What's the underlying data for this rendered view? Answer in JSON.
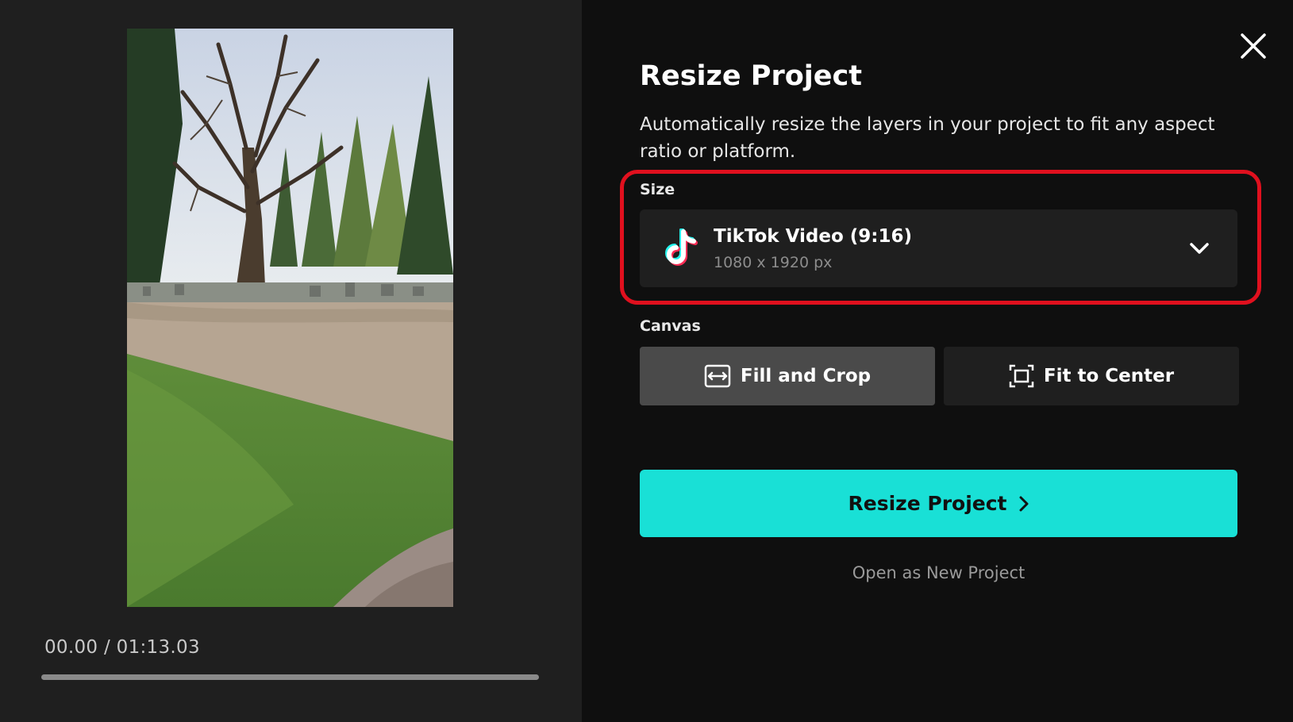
{
  "preview": {
    "current_time": "00.00",
    "separator": " / ",
    "duration": "01:13.03",
    "progress": 0
  },
  "dialog": {
    "title": "Resize Project",
    "description": "Automatically resize the layers in your project to fit any aspect ratio or platform.",
    "close_icon": "close-icon"
  },
  "size": {
    "label": "Size",
    "selected_name": "TikTok Video (9:16)",
    "selected_dims": "1080 x 1920 px",
    "icon": "tiktok-icon"
  },
  "canvas": {
    "label": "Canvas",
    "options": [
      {
        "label": "Fill and Crop",
        "icon": "fill-crop-icon",
        "selected": true
      },
      {
        "label": "Fit to Center",
        "icon": "fit-center-icon",
        "selected": false
      }
    ]
  },
  "actions": {
    "primary_label": "Resize Project",
    "secondary_label": "Open as New Project"
  },
  "colors": {
    "accent": "#19e0d6",
    "highlight": "#e0101e",
    "selected_option": "#4a4a4a"
  }
}
